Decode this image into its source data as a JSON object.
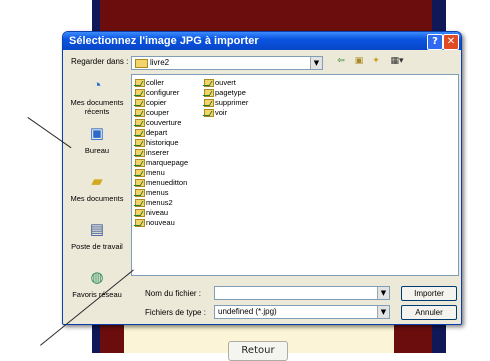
{
  "dialog": {
    "title": "Sélectionnez l'image JPG à importer",
    "help_glyph": "?",
    "close_glyph": "✕",
    "look_in_label": "Regarder dans :",
    "look_in_value": "livre2",
    "places": [
      {
        "label": "Mes documents récents"
      },
      {
        "label": "Bureau"
      },
      {
        "label": "Mes documents"
      },
      {
        "label": "Poste de travail"
      },
      {
        "label": "Favoris réseau"
      }
    ],
    "files_col1": [
      "coller",
      "configurer",
      "copier",
      "couper",
      "couverture",
      "depart",
      "historique",
      "inserer",
      "marquepage",
      "menu",
      "menueditton",
      "menus",
      "menus2",
      "niveau",
      "nouveau"
    ],
    "files_col2": [
      "ouvert",
      "pagetype",
      "supprimer",
      "voir"
    ],
    "filename_label": "Nom du fichier :",
    "filename_value": "",
    "filetype_label": "Fichiers de type :",
    "filetype_value": "undefined (*.jpg)",
    "import_button": "Importer",
    "cancel_button": "Annuler"
  },
  "page": {
    "retour_button": "Retour"
  },
  "icons": {
    "back": "⇦",
    "up_folder": "▣",
    "new_folder": "✦",
    "view_menu": "▦▾",
    "dropdown": "▼"
  }
}
